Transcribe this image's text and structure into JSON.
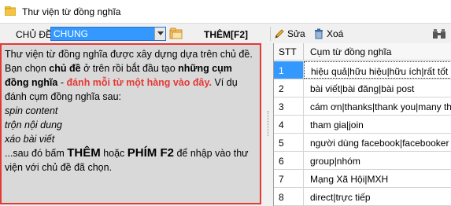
{
  "window": {
    "title": "Thư viện từ đồng nghĩa"
  },
  "toolbar": {
    "topic_label": "CHỦ ĐỀ:",
    "topic_value": "CHUNG",
    "add_label": "THÊM[F2]",
    "edit_label": "Sửa",
    "delete_label": "Xoá"
  },
  "help": {
    "p1a": "Thư viện từ đồng nghĩa được xây dựng dựa trên chủ đề. Bạn chọn ",
    "p1b": "chủ đề",
    "p1c": " ở trên rồi bắt đầu tạo ",
    "p1d": "những cụm đồng nghĩa",
    "p1e": " - ",
    "p1f": "đánh mỗi từ một hàng vào đây.",
    "p1g": " Ví dụ đánh cụm đồng nghĩa sau:",
    "ex1": "spin content",
    "ex2": "trộn nội dung",
    "ex3": "xáo bài viết",
    "p2a": "...sau đó bấm ",
    "p2b": "THÊM",
    "p2c": " hoặc ",
    "p2d": "PHÍM F2",
    "p2e": " để nhập vào thư viện với chủ đề đã chọn."
  },
  "grid": {
    "col_stt": "STT",
    "col_phrase": "Cụm từ đồng nghĩa",
    "rows": [
      {
        "stt": "1",
        "phrase": "hiệu quả|hữu hiệu|hữu ích|rất tốt"
      },
      {
        "stt": "2",
        "phrase": "bài viết|bài đăng|bài post"
      },
      {
        "stt": "3",
        "phrase": "cám ơn|thanks|thank you|many th"
      },
      {
        "stt": "4",
        "phrase": "tham gia|join"
      },
      {
        "stt": "5",
        "phrase": "người dùng facebook|facebooker"
      },
      {
        "stt": "6",
        "phrase": "group|nhóm"
      },
      {
        "stt": "7",
        "phrase": "Mạng Xã Hội|MXH"
      },
      {
        "stt": "8",
        "phrase": "direct|trực tiếp"
      }
    ]
  }
}
